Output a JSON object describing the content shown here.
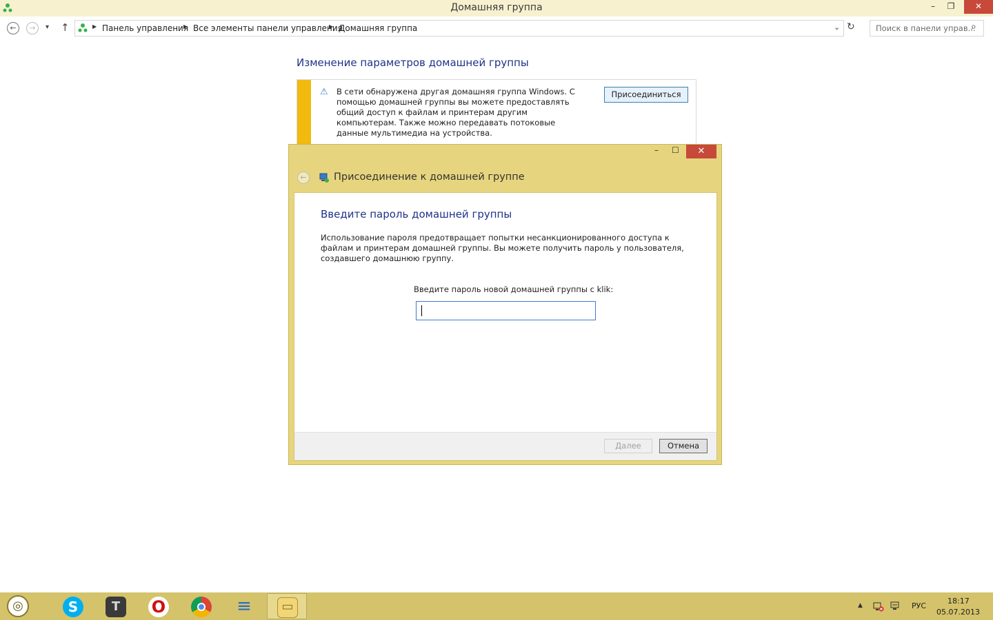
{
  "window": {
    "title": "Домашняя группа",
    "minimize": "–",
    "restore": "❐",
    "close": "✕"
  },
  "nav": {
    "back": "←",
    "forward": "→",
    "recent": "▾",
    "up": "↑",
    "breadcrumbs": [
      "Панель управления",
      "Все элементы панели управления",
      "Домашняя группа"
    ],
    "refresh": "↻",
    "search_placeholder": "Поиск в панели управ...",
    "search_icon": "⌕"
  },
  "page": {
    "heading": "Изменение параметров домашней группы",
    "notice_icon": "⚠",
    "notice_text": "В сети обнаружена другая домашняя группа Windows. С помощью домашней группы вы можете предоставлять общий доступ к файлам и принтерам другим компьютерам. Также можно передавать потоковые данные мультимедиа на устройства.",
    "join_button": "Присоединиться"
  },
  "dialog": {
    "title": "Присоединение к домашней группе",
    "back": "←",
    "minimize": "–",
    "maximize": "☐",
    "close": "✕",
    "heading": "Введите пароль домашней группы",
    "description": "Использование пароля предотвращает попытки несанкционированного доступа к файлам и принтерам домашней группы. Вы можете получить пароль у пользователя, создавшего домашнюю группу.",
    "password_label": "Введите пароль новой домашней группы с klik:",
    "password_value": "",
    "next_button": "Далее",
    "cancel_button": "Отмена"
  },
  "taskbar": {
    "start_glyph": "◎",
    "apps": [
      {
        "name": "skype-icon",
        "glyph": "S",
        "color": "#00aff0"
      },
      {
        "name": "world-of-tanks-icon",
        "glyph": "T",
        "color": "#2b2b2b"
      },
      {
        "name": "opera-icon",
        "glyph": "O",
        "color": "#d01010"
      },
      {
        "name": "chrome-icon",
        "glyph": "◉",
        "color": "#4a8cf0"
      },
      {
        "name": "control-panel-app-icon",
        "glyph": "≡",
        "color": "#2b6cc4"
      },
      {
        "name": "file-explorer-icon",
        "glyph": "▭",
        "color": "#e8c250"
      }
    ],
    "tray_arrow": "▲",
    "language": "РУС",
    "time": "18:17",
    "date": "05.07.2013"
  },
  "colors": {
    "accent_yellow": "#e6d57e",
    "taskbar": "#d4c36b",
    "heading_blue": "#1e3287",
    "notice_stripe": "#f2b90f",
    "close_red": "#c7493a"
  }
}
